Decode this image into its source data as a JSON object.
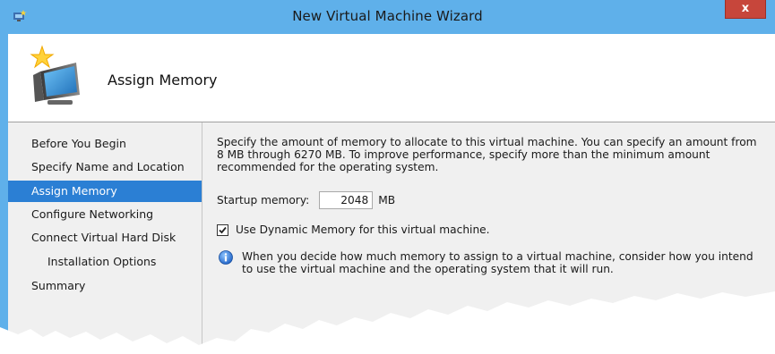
{
  "window": {
    "title": "New Virtual Machine Wizard",
    "close_glyph": "x"
  },
  "header": {
    "title": "Assign Memory",
    "icon": "computer-with-star-icon"
  },
  "nav": {
    "items": [
      {
        "label": "Before You Begin",
        "active": false,
        "sub": false
      },
      {
        "label": "Specify Name and Location",
        "active": false,
        "sub": false
      },
      {
        "label": "Assign Memory",
        "active": true,
        "sub": false
      },
      {
        "label": "Configure Networking",
        "active": false,
        "sub": false
      },
      {
        "label": "Connect Virtual Hard Disk",
        "active": false,
        "sub": false
      },
      {
        "label": "Installation Options",
        "active": false,
        "sub": true
      },
      {
        "label": "Summary",
        "active": false,
        "sub": false
      }
    ]
  },
  "main": {
    "description": "Specify the amount of memory to allocate to this virtual machine. You can specify an amount from 8 MB through 6270 MB. To improve performance, specify more than the minimum amount recommended for the operating system.",
    "startup_memory_label": "Startup memory:",
    "startup_memory_value": "2048",
    "startup_memory_unit": "MB",
    "dynamic_memory_label": "Use Dynamic Memory for this virtual machine.",
    "dynamic_memory_checked": true,
    "info_text": "When you decide how much memory to assign to a virtual machine, consider how you intend to use the virtual machine and the operating system that it will run.",
    "info_icon": "info-icon"
  },
  "colors": {
    "titlebar": "#5fb0ea",
    "selection": "#2b7fd4",
    "close_button": "#c7463b",
    "panel_bg": "#f0f0f0"
  }
}
